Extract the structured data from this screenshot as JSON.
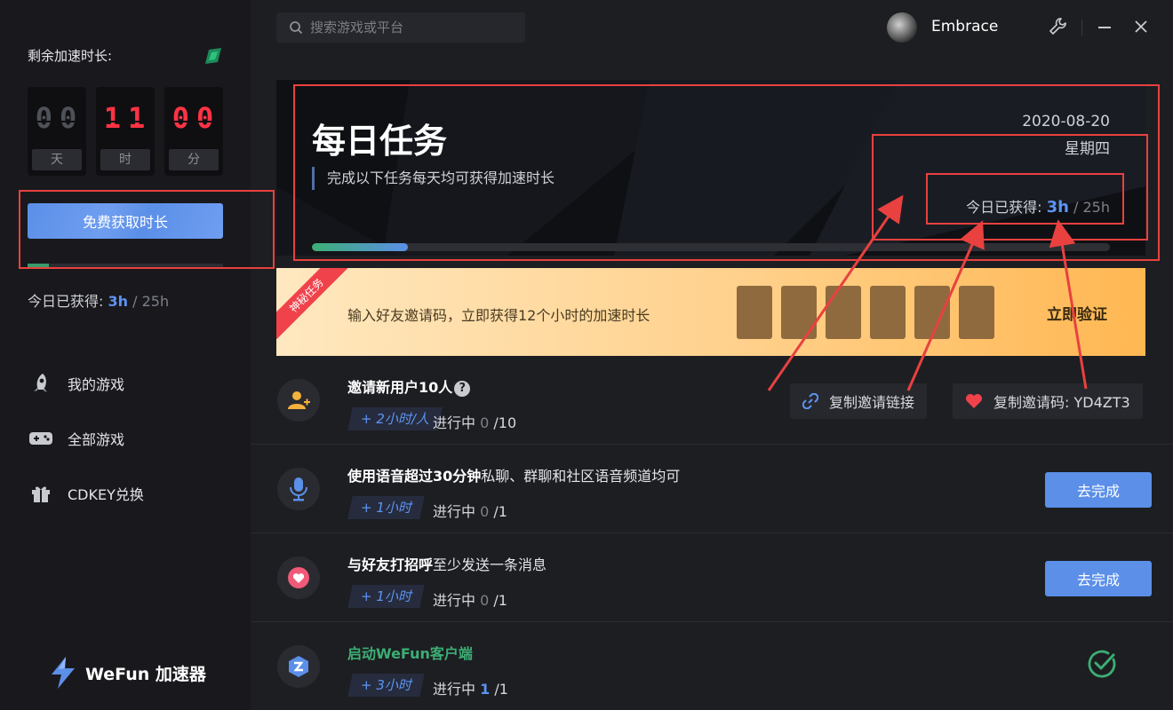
{
  "sidebar": {
    "remain_title": "剩余加速时长:",
    "timer": [
      {
        "digits": "00",
        "unit": "天"
      },
      {
        "digits": "11",
        "unit": "时"
      },
      {
        "digits": "00",
        "unit": "分"
      }
    ],
    "free_button": "免费获取时长",
    "today_label": "今日已获得:",
    "today_hours": "3h",
    "today_total": "/ 25h",
    "nav": [
      {
        "label": "我的游戏",
        "icon": "rocket-icon"
      },
      {
        "label": "全部游戏",
        "icon": "gamepad-icon"
      },
      {
        "label": "CDKEY兑换",
        "icon": "gift-icon"
      }
    ],
    "brand_name": "WeFun 加速器"
  },
  "topbar": {
    "search_placeholder": "搜索游戏或平台",
    "username": "Embrace"
  },
  "banner": {
    "title": "每日任务",
    "subtitle": "完成以下任务每天均可获得加速时长",
    "date": "2020-08-20",
    "weekday": "星期四",
    "gain_label": "今日已获得:",
    "gain_hours": "3h",
    "gain_total": "/ 25h",
    "progress_fraction": 0.12
  },
  "invite_strip": {
    "ribbon": "神秘任务",
    "text": "输入好友邀请码，立即获得12个小时的加速时长",
    "code_slots": 6,
    "verify_label": "立即验证"
  },
  "tasks": [
    {
      "title_bold": "邀请新用户10人",
      "title_rest": "",
      "reward": "+ 2小时/人",
      "status_label": "进行中",
      "progress": "0",
      "total": "/10",
      "icon": "add-user-icon",
      "copy_link_label": "复制邀请链接",
      "copy_code_label": "复制邀请码: YD4ZT3"
    },
    {
      "title_bold": "使用语音超过30分钟",
      "title_rest": "私聊、群聊和社区语音频道均可",
      "reward": "+ 1小时",
      "status_label": "进行中",
      "progress": "0",
      "total": "/1",
      "icon": "microphone-icon",
      "button": "去完成"
    },
    {
      "title_bold": "与好友打招呼",
      "title_rest": "至少发送一条消息",
      "reward": "+ 1小时",
      "status_label": "进行中",
      "progress": "0",
      "total": "/1",
      "icon": "heart-chat-icon",
      "button": "去完成"
    },
    {
      "title_bold": "启动WeFun客户端",
      "title_rest": "",
      "reward": "+ 3小时",
      "status_label": "进行中",
      "progress": "1",
      "total": "/1",
      "icon": "wefun-app-icon",
      "completed": true
    }
  ],
  "colors": {
    "accent_blue": "#5b8fe8",
    "timer_red": "#ff3344",
    "annotation_red": "#e8413f",
    "success_green": "#3cae74"
  }
}
